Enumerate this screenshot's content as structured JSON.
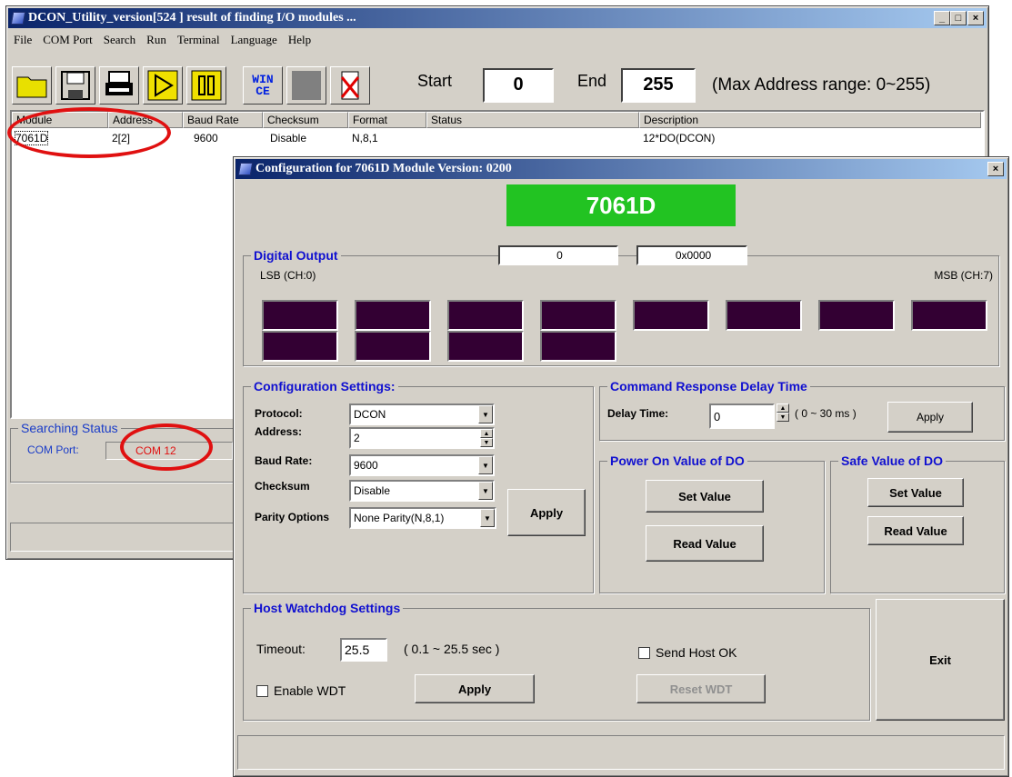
{
  "main_window": {
    "title": "DCON_Utility_version[524  ] result of finding I/O modules ...",
    "menu": [
      "File",
      "COM Port",
      "Search",
      "Run",
      "Terminal",
      "Language",
      "Help"
    ],
    "toolbar_icons": [
      "open-folder-icon",
      "save-icon",
      "print-icon",
      "play-icon",
      "pause-icon",
      "wince-icon",
      "blank-icon",
      "delete-icon"
    ],
    "wince_label": "WIN CE",
    "start_label": "Start",
    "start_value": "0",
    "end_label": "End",
    "end_value": "255",
    "range_text": "(Max Address range: 0~255)",
    "columns": [
      "Module",
      "Address",
      "Baud Rate",
      "Checksum",
      "Format",
      "Status",
      "Description"
    ],
    "rows": [
      {
        "module": "7061D",
        "address": "2[2]",
        "baud": "9600",
        "checksum": "Disable",
        "format": "N,8,1",
        "status": "",
        "description": "12*DO(DCON)"
      }
    ],
    "searching_status": {
      "title": "Searching Status",
      "com_port_label": "COM Port:",
      "com_port_value": "COM 12"
    }
  },
  "config_window": {
    "title": "Configuration for 7061D Module Version: 0200",
    "module_name": "7061D",
    "module_color": "#22c322",
    "digital_output": {
      "title": "Digital Output",
      "value_dec": "0",
      "value_hex": "0x0000",
      "lsb_label": "LSB (CH:0)",
      "msb_label": "MSB (CH:7)",
      "channels_on": [
        false,
        false,
        false,
        false,
        false,
        false,
        false,
        false,
        false,
        false,
        false,
        false
      ],
      "off_color": "#330033"
    },
    "config_settings": {
      "title": "Configuration Settings:",
      "protocol_label": "Protocol:",
      "protocol_value": "DCON",
      "address_label": "Address:",
      "address_value": "2",
      "baud_label": "Baud Rate:",
      "baud_value": "9600",
      "checksum_label": "Checksum",
      "checksum_value": "Disable",
      "parity_label": "Parity Options",
      "parity_value": "None Parity(N,8,1)",
      "apply_label": "Apply"
    },
    "command_delay": {
      "title": "Command Response Delay Time",
      "delay_label": "Delay Time:",
      "delay_value": "0",
      "range": "( 0 ~ 30 ms )",
      "apply_label": "Apply"
    },
    "power_on": {
      "title": "Power On Value of DO",
      "set_label": "Set Value",
      "read_label": "Read Value"
    },
    "safe_value": {
      "title": "Safe Value of DO",
      "set_label": "Set Value",
      "read_label": "Read Value"
    },
    "watchdog": {
      "title": "Host Watchdog Settings",
      "timeout_label": "Timeout:",
      "timeout_value": "25.5",
      "timeout_range": "( 0.1 ~ 25.5 sec )",
      "enable_label": "Enable WDT",
      "apply_label": "Apply",
      "send_host_label": "Send Host OK",
      "reset_label": "Reset WDT"
    },
    "exit_label": "Exit"
  }
}
